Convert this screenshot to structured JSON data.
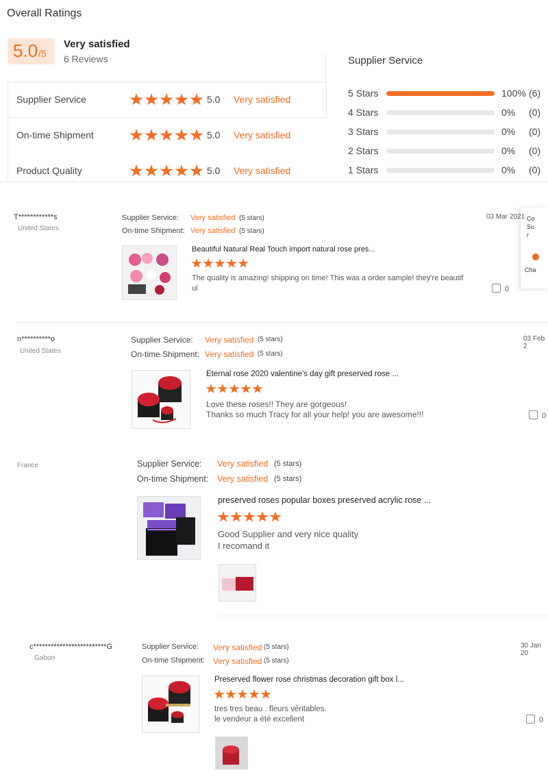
{
  "summary": {
    "title": "Overall Ratings",
    "score": "5.0",
    "score_suffix": "/5",
    "verdict": "Very satisfied",
    "reviews": "6 Reviews",
    "categories": [
      {
        "label": "Supplier Service",
        "score": "5.0",
        "desc": "Very satisfied",
        "stars": 5
      },
      {
        "label": "On-time Shipment",
        "score": "5.0",
        "desc": "Very satisfied",
        "stars": 5
      },
      {
        "label": "Product Quality",
        "score": "5.0",
        "desc": "Very satisfied",
        "stars": 5
      }
    ]
  },
  "distribution": {
    "title": "Supplier Service",
    "rows": [
      {
        "label": "5  Stars",
        "pct": "100%",
        "count": "(6)",
        "fraction": 1.0
      },
      {
        "label": "4  Stars",
        "pct": "0%",
        "count": "(0)",
        "fraction": 0
      },
      {
        "label": "3  Stars",
        "pct": "0%",
        "count": "(0)",
        "fraction": 0
      },
      {
        "label": "2  Stars",
        "pct": "0%",
        "count": "(0)",
        "fraction": 0
      },
      {
        "label": "1  Stars",
        "pct": "0%",
        "count": "(0)",
        "fraction": 0
      }
    ]
  },
  "popup": {
    "line1": "Co",
    "line2": "Su",
    "line3": "r",
    "line4": "Cha"
  },
  "reviews": [
    {
      "user": "T************s",
      "country": "United States",
      "supplier_label": "Supplier Service:",
      "supplier_val": "Very satisfied",
      "supplier_note": "(5 stars)",
      "shipment_label": "On-time Shipment:",
      "shipment_val": "Very satisfied",
      "shipment_note": "(5 stars)",
      "date": "03 Mar 2021",
      "product": "Beautiful Natural Real Touch import natural rose pres...",
      "text1": "The quality is amazing! shipping on time! This was a order sample! they're beautif",
      "text2": "ul",
      "likes": "0"
    },
    {
      "user": "n**********o",
      "country": "United States",
      "supplier_label": "Supplier Service:",
      "supplier_val": "Very satisfied",
      "supplier_note": "(5 stars)",
      "shipment_label": "On-time Shipment:",
      "shipment_val": "Very satisfied",
      "shipment_note": "(5 stars)",
      "date": "03 Feb 2",
      "product": "Eternal rose 2020 valentine's day gift preserved rose ...",
      "text1": "Love these roses!! They are gorgeous!",
      "text2": "Thanks so much Tracy for all your help! you are awesome!!!",
      "likes": "0"
    },
    {
      "user": "",
      "country": "France",
      "supplier_label": "Supplier Service:",
      "supplier_val": "Very satisfied",
      "supplier_note": "(5 stars)",
      "shipment_label": "On-time Shipment:",
      "shipment_val": "Very satisfied",
      "shipment_note": "(5 stars)",
      "date": "",
      "product": "preserved roses popular boxes preserved acrylic rose ...",
      "text1": "Good Supplier and very nice quality",
      "text2": "I recomand it",
      "likes": ""
    },
    {
      "user": "c*************************G",
      "country": "Gabon",
      "supplier_label": "Supplier Service:",
      "supplier_val": "Very satisfied",
      "supplier_note": "(5 stars)",
      "shipment_label": "On-time Shipment:",
      "shipment_val": "Very satisfied",
      "shipment_note": "(5 stars)",
      "date": "30 Jan 20",
      "product": "Preserved flower rose christmas decoration gift box l...",
      "text1": "tres tres beau . fleurs véritables.",
      "text2": "le vendeur a été excellent",
      "likes": "0"
    }
  ]
}
